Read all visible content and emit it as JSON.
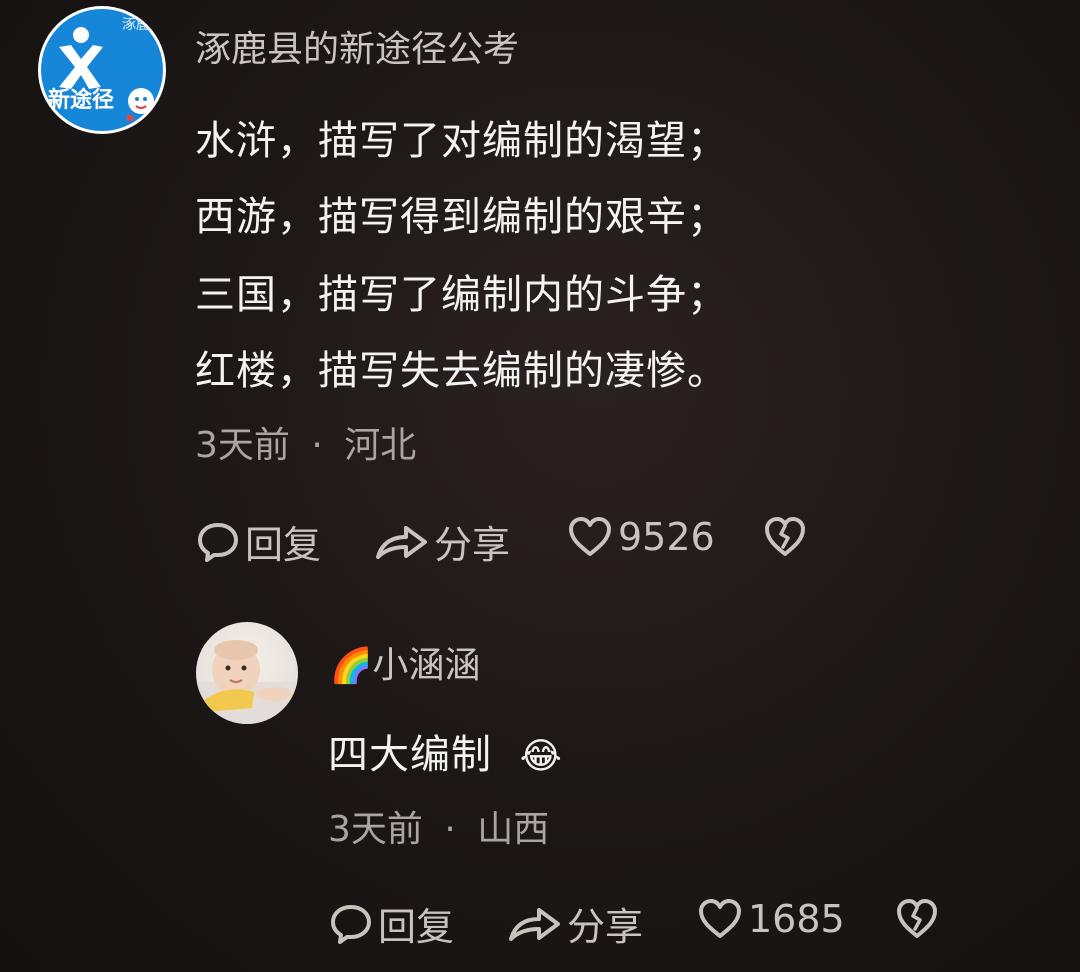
{
  "comment": {
    "author": "涿鹿县的新途径公考",
    "avatar_text": "新途径",
    "avatar_corner": "涿鹿",
    "lines": [
      "水浒，描写了对编制的渴望；",
      "西游，描写得到编制的艰辛；",
      "三国，描写了编制内的斗争；",
      "红楼，描写失去编制的凄惨。"
    ],
    "time": "3天前",
    "location": "河北",
    "reply_label": "回复",
    "share_label": "分享",
    "like_count": "9526"
  },
  "reply": {
    "author_emoji": "🌈",
    "author": "小涵涵",
    "text": "四大编制",
    "text_emoji": "😂",
    "time": "3天前",
    "location": "山西",
    "reply_label": "回复",
    "share_label": "分享",
    "like_count": "1685"
  },
  "meta_separator": "·",
  "icons": {
    "reply": "speech-bubble-icon",
    "share": "share-arrow-icon",
    "like": "heart-outline-icon",
    "dislike": "broken-heart-icon"
  },
  "colors": {
    "background": "#1d1816",
    "text": "#f5f3f1",
    "muted": "#aaa5a1",
    "avatar_blue": "#1686d9"
  }
}
